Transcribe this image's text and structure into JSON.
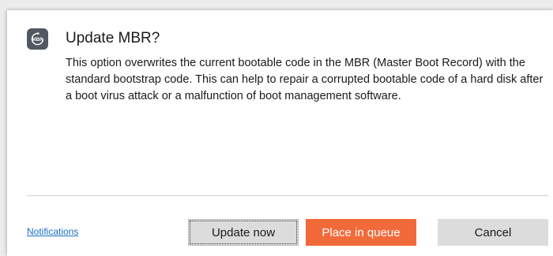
{
  "dialog": {
    "icon": {
      "name": "mbr-icon",
      "label": "MBR"
    },
    "title": "Update MBR?",
    "message": "This option overwrites the current bootable code in the MBR (Master Boot Record) with the standard bootstrap code. This can help to repair a corrupted bootable code of a hard disk after a boot virus attack or a malfunction of boot management software."
  },
  "footer": {
    "notifications_link": "Notifications",
    "update_now_label": "Update now",
    "place_in_queue_label": "Place in queue",
    "cancel_label": "Cancel"
  },
  "colors": {
    "accent": "#f26a3a",
    "link": "#1a6fc4",
    "icon_bg": "#505861",
    "secondary_button": "#dcdcdc"
  }
}
